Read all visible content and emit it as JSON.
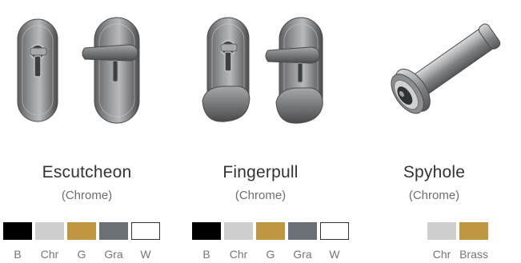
{
  "products": [
    {
      "name": "Escutcheon",
      "finish": "(Chrome)",
      "icon": "escutcheon-icon",
      "swatches": [
        {
          "label": "B",
          "color": "#000000"
        },
        {
          "label": "Chr",
          "color": "#cfcfcf"
        },
        {
          "label": "G",
          "color": "#c19640"
        },
        {
          "label": "Gra",
          "color": "#6b7075"
        },
        {
          "label": "W",
          "color": "#ffffff"
        }
      ]
    },
    {
      "name": "Fingerpull",
      "finish": "(Chrome)",
      "icon": "fingerpull-icon",
      "swatches": [
        {
          "label": "B",
          "color": "#000000"
        },
        {
          "label": "Chr",
          "color": "#cfcfcf"
        },
        {
          "label": "G",
          "color": "#c19640"
        },
        {
          "label": "Gra",
          "color": "#6b7075"
        },
        {
          "label": "W",
          "color": "#ffffff"
        }
      ]
    },
    {
      "name": "Spyhole",
      "finish": "(Chrome)",
      "icon": "spyhole-icon",
      "swatches": [
        {
          "label": "Chr",
          "color": "#cfcfcf"
        },
        {
          "label": "Brass",
          "color": "#c19640"
        }
      ]
    }
  ]
}
